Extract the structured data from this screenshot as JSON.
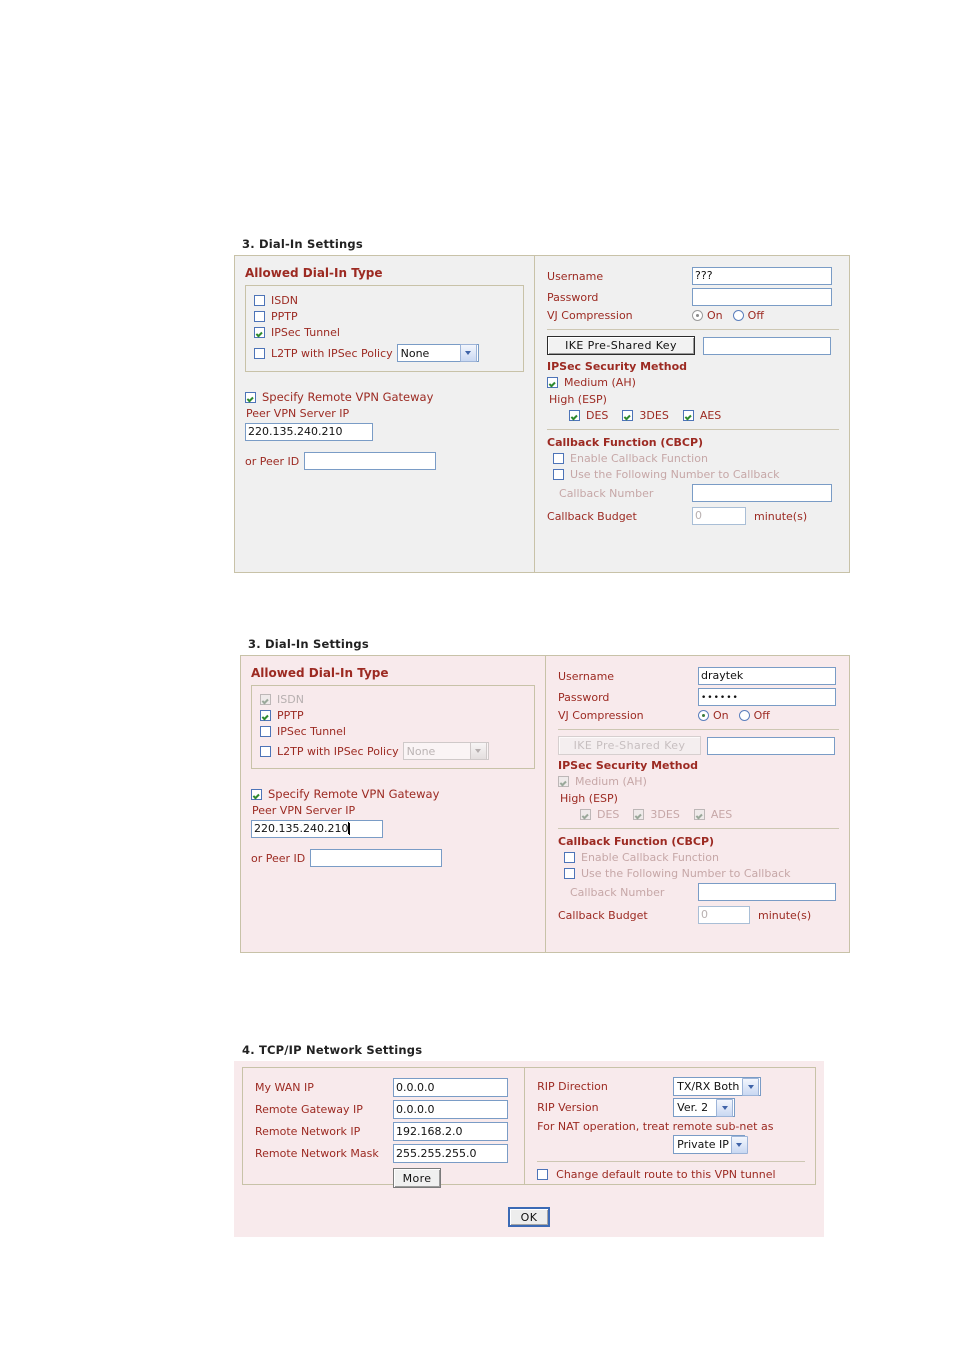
{
  "colors": {
    "label_red": "#9c2a22",
    "panel_grey": "#f0f0f0",
    "panel_rose": "#f8eaec",
    "border": "#c8c2a8",
    "input_border": "#7a9cc6",
    "check_green": "#2f8a2f"
  },
  "panel1": {
    "title": "3. Dial-In Settings",
    "left": {
      "group_title": "Allowed Dial-In Type",
      "options": [
        {
          "label": "ISDN",
          "checked": false,
          "disabled": false
        },
        {
          "label": "PPTP",
          "checked": false,
          "disabled": false
        },
        {
          "label": "IPSec Tunnel",
          "checked": true,
          "disabled": false
        },
        {
          "label": "L2TP with IPSec Policy",
          "checked": false,
          "disabled": false
        }
      ],
      "l2tp_policy_value": "None",
      "specify_gateway_label": "Specify Remote VPN Gateway",
      "specify_gateway_checked": true,
      "peer_ip_label": "Peer VPN Server IP",
      "peer_ip_value": "220.135.240.210",
      "peer_id_label": "or Peer ID",
      "peer_id_value": ""
    },
    "right": {
      "username_label": "Username",
      "username_value": "???",
      "password_label": "Password",
      "password_value": "",
      "vj_label": "VJ Compression",
      "vj_on_label": "On",
      "vj_off_label": "Off",
      "vj_selected": "On",
      "ike_button_label": "IKE Pre-Shared Key",
      "ike_value": "",
      "ipsec_title": "IPSec Security Method",
      "medium_label": "Medium (AH)",
      "medium_checked": true,
      "high_label": "High (ESP)",
      "high_options": [
        {
          "label": "DES",
          "checked": true
        },
        {
          "label": "3DES",
          "checked": true
        },
        {
          "label": "AES",
          "checked": true
        }
      ],
      "callback_title": "Callback Function (CBCP)",
      "enable_callback_label": "Enable Callback Function",
      "enable_callback_checked": false,
      "use_number_label": "Use the Following Number to Callback",
      "use_number_checked": false,
      "callback_number_label": "Callback Number",
      "callback_number_value": "",
      "callback_budget_label": "Callback Budget",
      "callback_budget_value": "0",
      "minutes_label": "minute(s)"
    }
  },
  "panel2": {
    "title": "3. Dial-In Settings",
    "left": {
      "group_title": "Allowed Dial-In Type",
      "options": [
        {
          "label": "ISDN",
          "checked": true,
          "disabled": true
        },
        {
          "label": "PPTP",
          "checked": true,
          "disabled": false
        },
        {
          "label": "IPSec Tunnel",
          "checked": false,
          "disabled": false
        },
        {
          "label": "L2TP with IPSec Policy",
          "checked": false,
          "disabled": false
        }
      ],
      "l2tp_policy_value": "None",
      "specify_gateway_label": "Specify Remote VPN Gateway",
      "specify_gateway_checked": true,
      "peer_ip_label": "Peer VPN Server IP",
      "peer_ip_value": "220.135.240.210",
      "peer_id_label": "or Peer ID",
      "peer_id_value": ""
    },
    "right": {
      "username_label": "Username",
      "username_value": "draytek",
      "password_label": "Password",
      "password_value": "••••••",
      "vj_label": "VJ Compression",
      "vj_on_label": "On",
      "vj_off_label": "Off",
      "vj_selected": "On",
      "ike_button_label": "IKE Pre-Shared Key",
      "ike_value": "",
      "ipsec_title": "IPSec Security Method",
      "medium_label": "Medium (AH)",
      "medium_checked": true,
      "high_label": "High (ESP)",
      "high_options": [
        {
          "label": "DES",
          "checked": true
        },
        {
          "label": "3DES",
          "checked": true
        },
        {
          "label": "AES",
          "checked": true
        }
      ],
      "callback_title": "Callback Function (CBCP)",
      "enable_callback_label": "Enable Callback Function",
      "enable_callback_checked": false,
      "use_number_label": "Use the Following Number to Callback",
      "use_number_checked": false,
      "callback_number_label": "Callback Number",
      "callback_number_value": "",
      "callback_budget_label": "Callback Budget",
      "callback_budget_value": "0",
      "minutes_label": "minute(s)"
    }
  },
  "panel3": {
    "title": "4. TCP/IP Network Settings",
    "left": {
      "fields": [
        {
          "label": "My WAN IP",
          "value": "0.0.0.0"
        },
        {
          "label": "Remote Gateway IP",
          "value": "0.0.0.0"
        },
        {
          "label": "Remote Network IP",
          "value": "192.168.2.0"
        },
        {
          "label": "Remote Network Mask",
          "value": "255.255.255.0"
        }
      ],
      "more_button_label": "More"
    },
    "right": {
      "rip_direction_label": "RIP Direction",
      "rip_direction_value": "TX/RX Both",
      "rip_version_label": "RIP Version",
      "rip_version_value": "Ver. 2",
      "nat_label": "For NAT operation, treat remote sub-net as",
      "nat_value": "Private IP",
      "change_route_label": "Change default route to this VPN tunnel",
      "change_route_checked": false
    },
    "ok_button_label": "OK"
  }
}
